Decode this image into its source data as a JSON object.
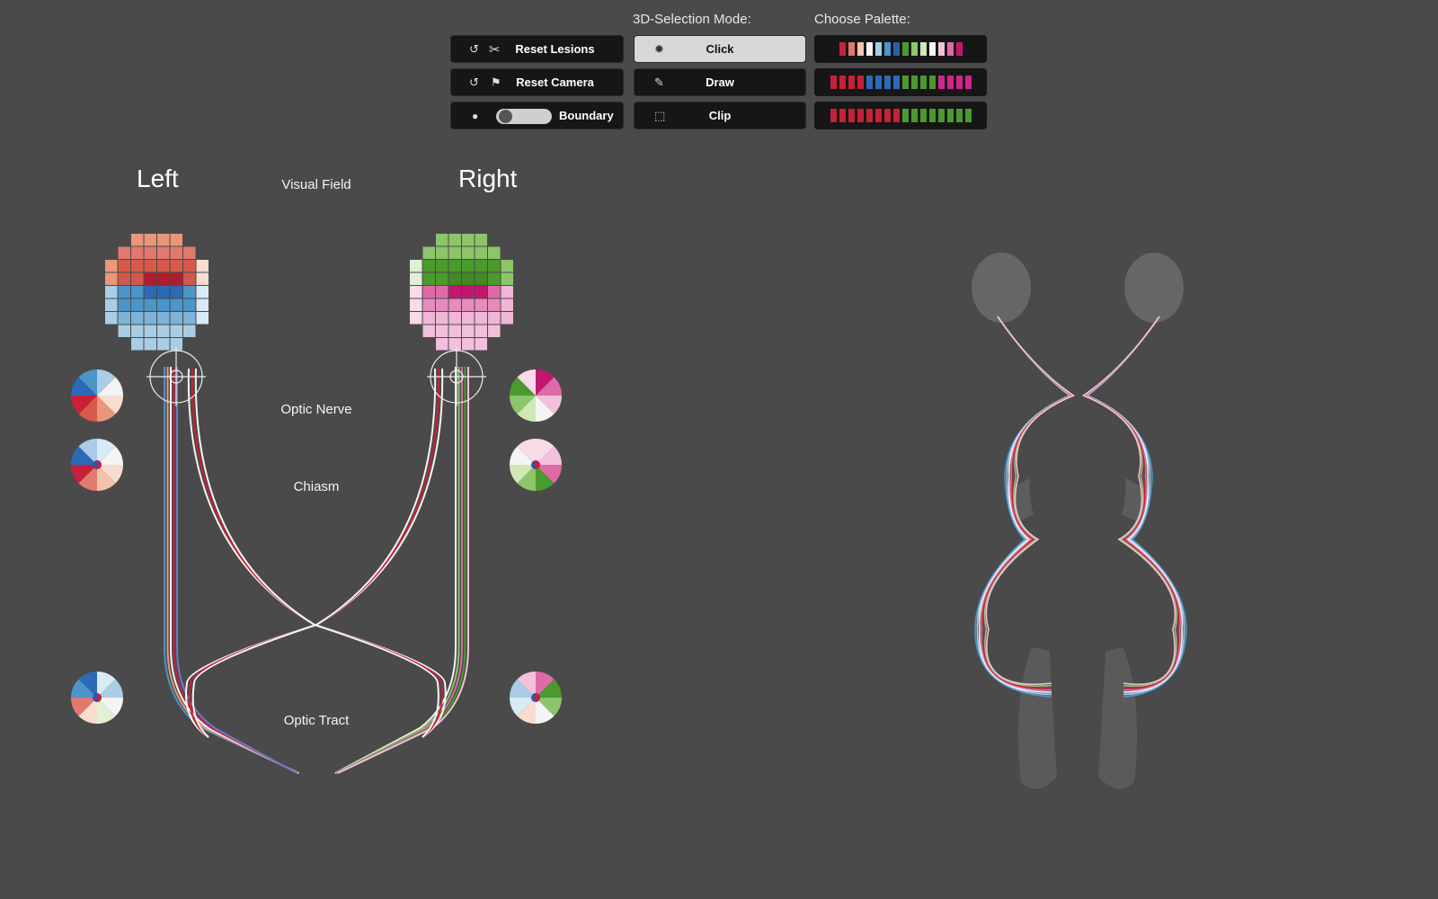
{
  "headers": {
    "selection_mode": "3D-Selection Mode:",
    "palette": "Choose Palette:"
  },
  "buttons": {
    "reset_lesions": "Reset Lesions",
    "reset_camera": "Reset Camera",
    "boundary": "Boundary",
    "click": "Click",
    "draw": "Draw",
    "clip": "Clip"
  },
  "selected_mode": "Click",
  "boundary_on": false,
  "palettes": [
    [
      "#c8203a",
      "#e2796e",
      "#f3c3ad",
      "#f4f4f4",
      "#a8cde4",
      "#4b95c8",
      "#2c5fa6",
      "#4a9a2d",
      "#8cc56a",
      "#cfe8b5",
      "#f4f4f4",
      "#f3c0dc",
      "#de6aa8",
      "#c1186f"
    ],
    [
      "#c8203a",
      "#c8203a",
      "#c8203a",
      "#c8203a",
      "#2c6ab8",
      "#2c6ab8",
      "#2c6ab8",
      "#2c6ab8",
      "#4a9a2d",
      "#4a9a2d",
      "#4a9a2d",
      "#4a9a2d",
      "#d0258b",
      "#d0258b",
      "#d0258b",
      "#d0258b"
    ],
    [
      "#c8203a",
      "#c8203a",
      "#c8203a",
      "#c8203a",
      "#c8203a",
      "#c8203a",
      "#c8203a",
      "#c8203a",
      "#4a9a2d",
      "#4a9a2d",
      "#4a9a2d",
      "#4a9a2d",
      "#4a9a2d",
      "#4a9a2d",
      "#4a9a2d",
      "#4a9a2d"
    ]
  ],
  "labels": {
    "left": "Left",
    "right": "Right",
    "visual_field": "Visual Field",
    "optic_nerve": "Optic Nerve",
    "chiasm": "Chiasm",
    "optic_tract": "Optic Tract"
  },
  "colors": {
    "background": "#4a4a4a",
    "button": "#161616",
    "selected_button": "#d7d7d7"
  }
}
